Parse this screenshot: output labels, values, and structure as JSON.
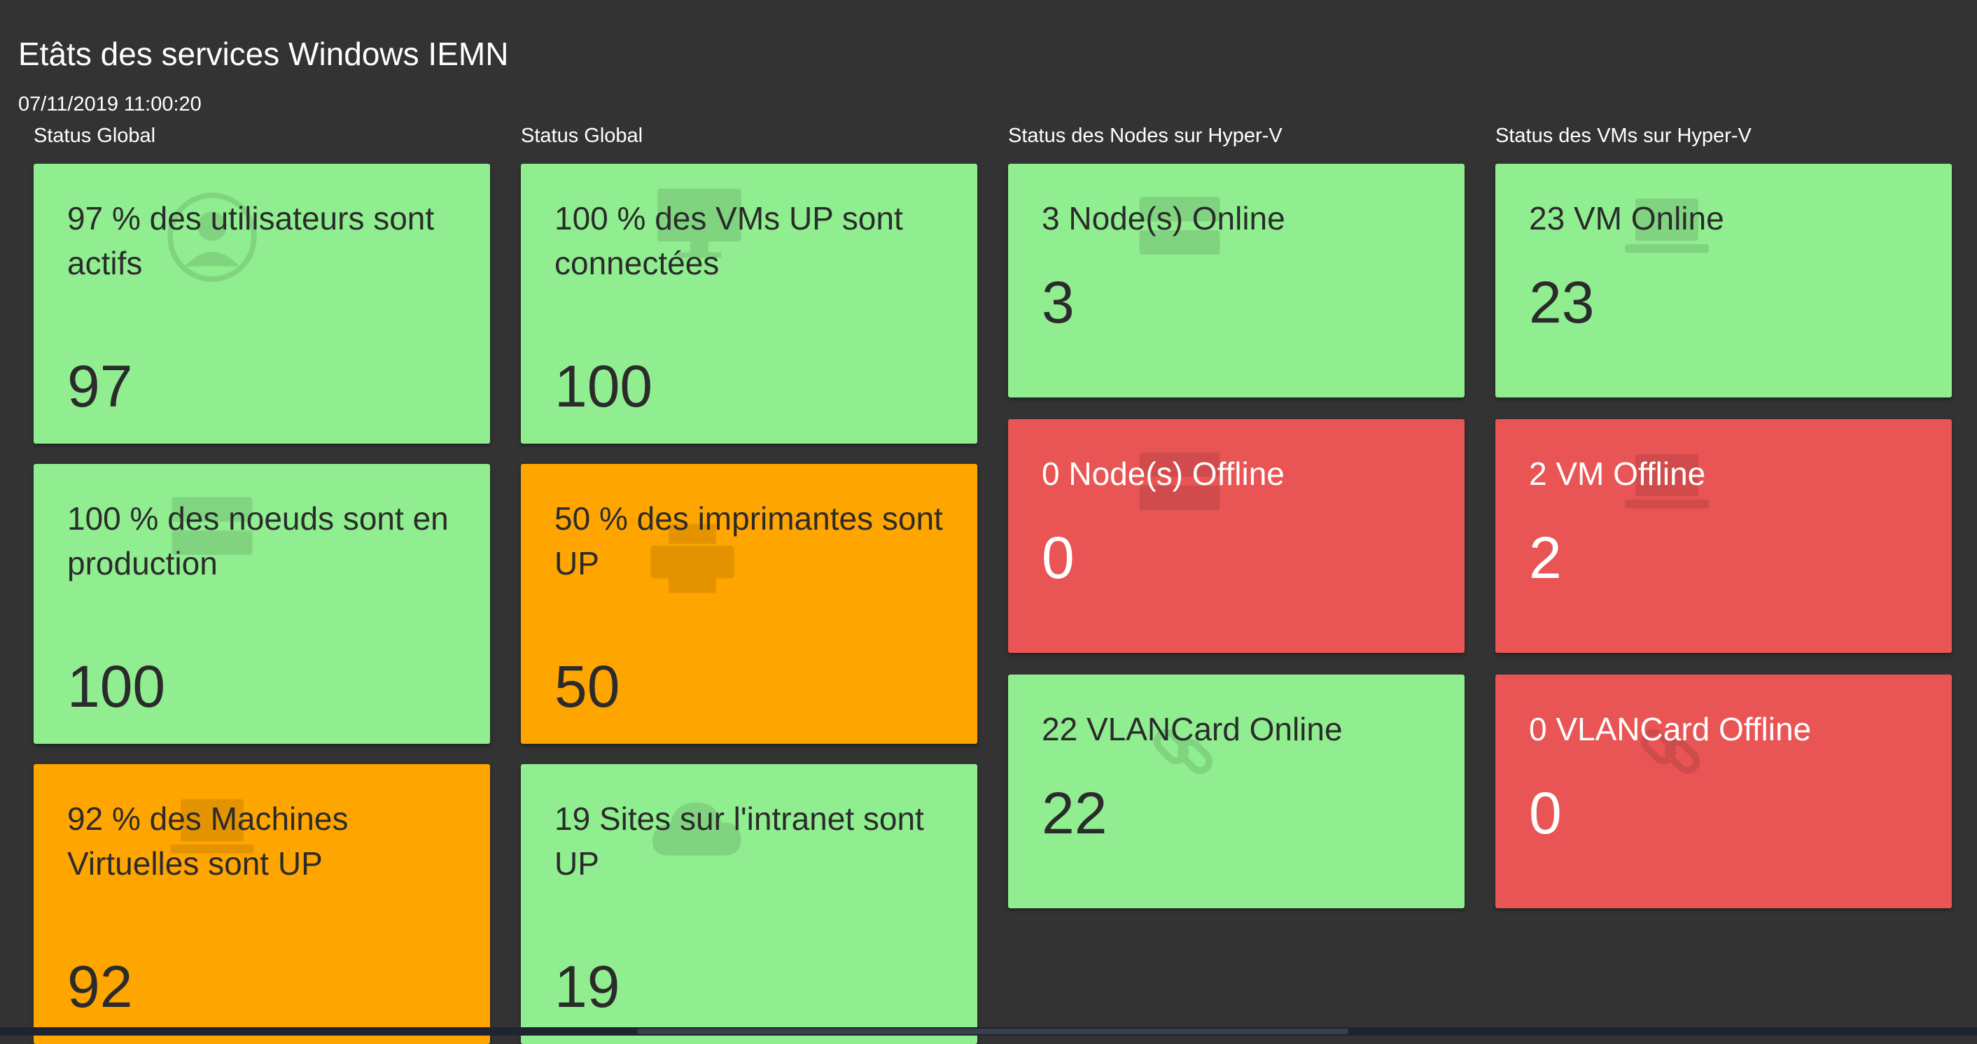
{
  "page": {
    "title": "Etâts des services Windows IEMN",
    "timestamp": "07/11/2019 11:00:20"
  },
  "columns": [
    {
      "header": "Status Global",
      "tiles": [
        {
          "label": "97 % des utilisateurs sont actifs",
          "value": "97",
          "status": "green",
          "icon": "user-icon"
        },
        {
          "label": "100 % des noeuds sont en production",
          "value": "100",
          "status": "green",
          "icon": "server-icon"
        },
        {
          "label": "92 % des Machines Virtuelles sont UP",
          "value": "92",
          "status": "orange",
          "icon": "laptop-icon"
        }
      ]
    },
    {
      "header": "Status Global",
      "tiles": [
        {
          "label": "100 % des VMs UP sont connectées",
          "value": "100",
          "status": "green",
          "icon": "monitor-icon"
        },
        {
          "label": "50 % des imprimantes sont UP",
          "value": "50",
          "status": "orange",
          "icon": "printer-icon"
        },
        {
          "label": "19 Sites sur l'intranet sont UP",
          "value": "19",
          "status": "green",
          "icon": "cloud-icon"
        }
      ]
    },
    {
      "header": "Status des Nodes sur Hyper-V",
      "tiles": [
        {
          "label": "3 Node(s) Online",
          "value": "3",
          "status": "green",
          "icon": "server-icon"
        },
        {
          "label": "0 Node(s) Offline",
          "value": "0",
          "status": "red",
          "icon": "server-icon"
        },
        {
          "label": "22 VLANCard Online",
          "value": "22",
          "status": "green",
          "icon": "link-icon"
        }
      ]
    },
    {
      "header": "Status des VMs sur Hyper-V",
      "tiles": [
        {
          "label": "23 VM Online",
          "value": "23",
          "status": "green",
          "icon": "laptop-icon"
        },
        {
          "label": "2 VM Offline",
          "value": "2",
          "status": "red",
          "icon": "laptop-icon"
        },
        {
          "label": "0 VLANCard Offline",
          "value": "0",
          "status": "red",
          "icon": "link-icon"
        }
      ]
    }
  ],
  "colors": {
    "background": "#333333",
    "ok": "#90ee90",
    "warning": "#ffa500",
    "error": "#e95555"
  }
}
